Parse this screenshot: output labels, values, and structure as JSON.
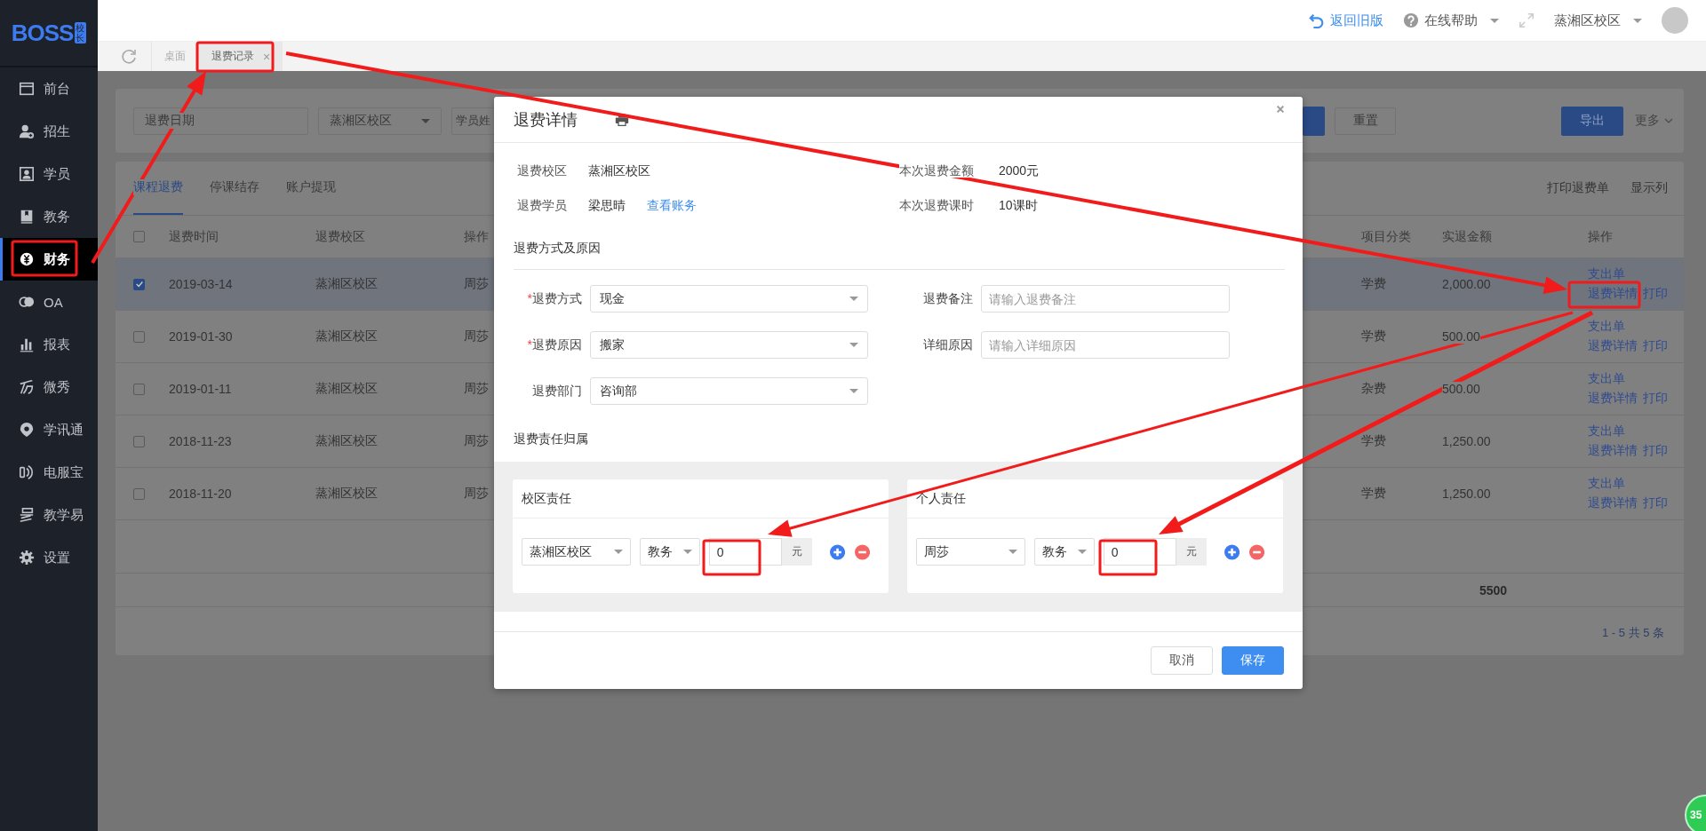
{
  "sidebar": {
    "logo": "BOSS",
    "logo_badge": "校长",
    "items": [
      {
        "label": "前台",
        "selected": false
      },
      {
        "label": "招生",
        "selected": false
      },
      {
        "label": "学员",
        "selected": false
      },
      {
        "label": "教务",
        "selected": false
      },
      {
        "label": "财务",
        "selected": true
      },
      {
        "label": "OA",
        "selected": false
      },
      {
        "label": "报表",
        "selected": false
      },
      {
        "label": "微秀",
        "selected": false
      },
      {
        "label": "学讯通",
        "selected": false
      },
      {
        "label": "电服宝",
        "selected": false
      },
      {
        "label": "教学易",
        "selected": false
      },
      {
        "label": "设置",
        "selected": false
      }
    ]
  },
  "header": {
    "back_link": "返回旧版",
    "help": "在线帮助",
    "campus": "蒸湘区校区"
  },
  "page_tabs": [
    {
      "label": "桌面",
      "selected": false
    },
    {
      "label": "退费记录",
      "selected": true,
      "close": "×"
    }
  ],
  "filters": {
    "date_placeholder": "退费日期",
    "campus": "蒸湘区校区",
    "student_placeholder": "学员姓",
    "reset": "重置",
    "export": "导出",
    "more": "更多"
  },
  "table": {
    "tabs": [
      {
        "label": "课程退费",
        "selected": true
      },
      {
        "label": "停课结存",
        "selected": false
      },
      {
        "label": "账户提现",
        "selected": false
      }
    ],
    "actions": [
      "打印退费单",
      "显示列"
    ],
    "header_checked": false,
    "columns_left": [
      "退费时间",
      "退费校区",
      "操作"
    ],
    "columns_right": [
      "项目分类",
      "实退金额",
      "操作"
    ],
    "rows": [
      {
        "selected": true,
        "date": "2019-03-14",
        "campus": "蒸湘区校区",
        "operator": "周莎",
        "category": "学费",
        "amount": "2,000.00",
        "links": [
          "支出单",
          "退费详情",
          "打印"
        ]
      },
      {
        "selected": false,
        "date": "2019-01-30",
        "campus": "蒸湘区校区",
        "operator": "周莎",
        "category": "学费",
        "amount": "500.00",
        "links": [
          "支出单",
          "退费详情",
          "打印"
        ]
      },
      {
        "selected": false,
        "date": "2019-01-11",
        "campus": "蒸湘区校区",
        "operator": "周莎",
        "category": "杂费",
        "amount": "500.00",
        "links": [
          "支出单",
          "退费详情",
          "打印"
        ]
      },
      {
        "selected": false,
        "date": "2018-11-23",
        "campus": "蒸湘区校区",
        "operator": "周莎",
        "category": "学费",
        "amount": "1,250.00",
        "links": [
          "支出单",
          "退费详情",
          "打印"
        ]
      },
      {
        "selected": false,
        "date": "2018-11-20",
        "campus": "蒸湘区校区",
        "operator": "周莎",
        "category": "学费",
        "amount": "1,250.00",
        "links": [
          "支出单",
          "退费详情",
          "打印"
        ]
      }
    ],
    "total": "5500",
    "pagination": "1 - 5   共 5 条"
  },
  "dialog": {
    "title": "退费详情",
    "info": [
      {
        "label": "退费校区",
        "value": "蒸湘区校区"
      },
      {
        "label": "本次退费金额",
        "value": "2000元"
      },
      {
        "label": "退费学员",
        "value": "梁思晴",
        "link": "查看账务"
      },
      {
        "label": "本次退费课时",
        "value": "10课时"
      }
    ],
    "method_title": "退费方式及原因",
    "fields": [
      {
        "kind": "select",
        "label": "退费方式",
        "required_mark": "*",
        "value": "现金"
      },
      {
        "kind": "input",
        "label": "退费备注",
        "placeholder": "请输入退费备注"
      },
      {
        "kind": "select",
        "label": "退费原因",
        "required_mark": "*",
        "value": "搬家"
      },
      {
        "kind": "input",
        "label": "详细原因",
        "placeholder": "请输入详细原因"
      },
      {
        "kind": "select",
        "label": "退费部门",
        "value": "咨询部"
      }
    ],
    "responsibility_title": "退费责任归属",
    "panels": [
      {
        "title": "校区责任",
        "rows": [
          {
            "who": "蒸湘区校区",
            "dept": "教务",
            "amount": "0",
            "unit": "元"
          }
        ]
      },
      {
        "title": "个人责任",
        "rows": [
          {
            "who": "周莎",
            "dept": "教务",
            "amount": "0",
            "unit": "元"
          }
        ]
      }
    ],
    "cancel": "取消",
    "save": "保存"
  },
  "badge": "35"
}
